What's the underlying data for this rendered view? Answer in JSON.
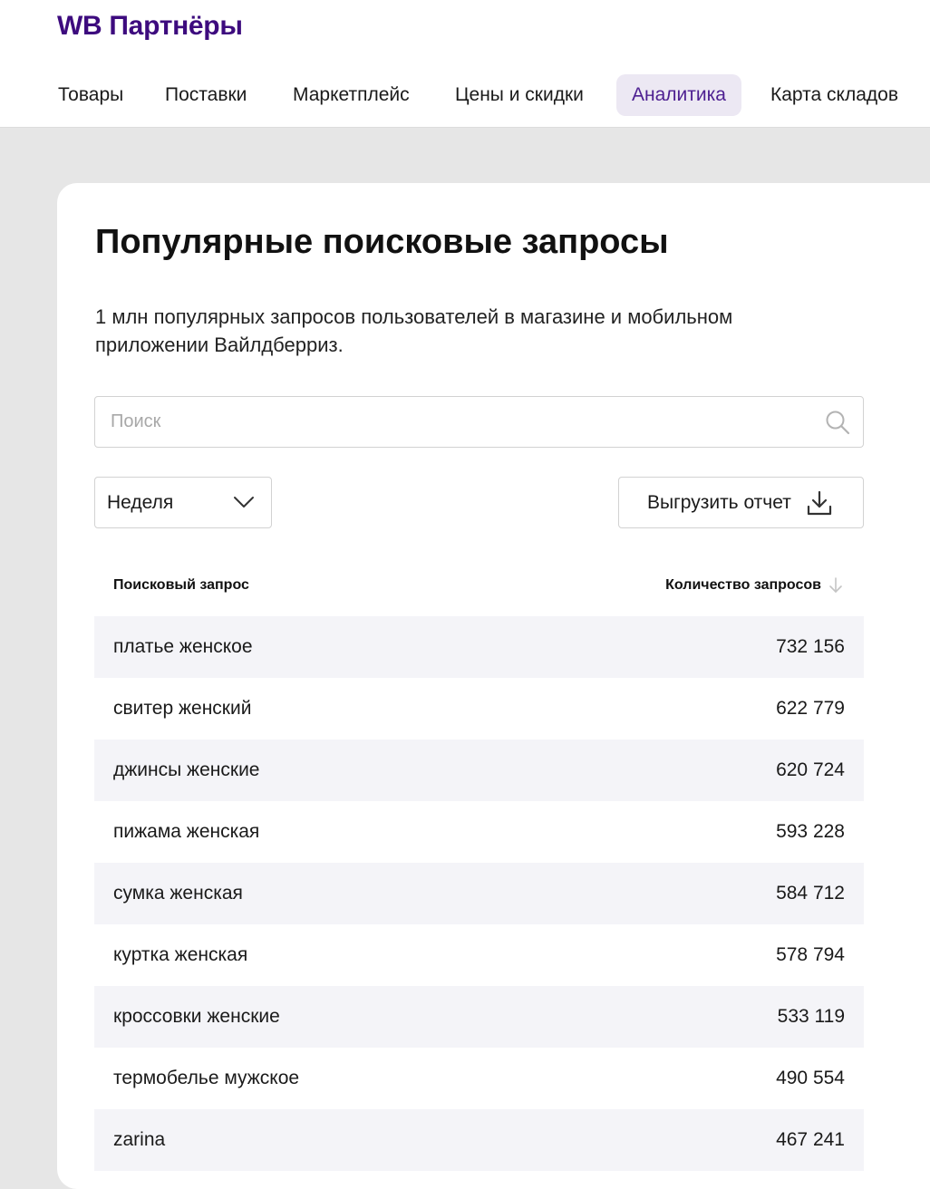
{
  "app": {
    "logo": "WB Партнёры"
  },
  "nav": {
    "items": [
      {
        "label": "Товары",
        "active": false
      },
      {
        "label": "Поставки",
        "active": false
      },
      {
        "label": "Маркетплейс",
        "active": false
      },
      {
        "label": "Цены и скидки",
        "active": false
      },
      {
        "label": "Аналитика",
        "active": true
      },
      {
        "label": "Карта складов",
        "active": false
      }
    ]
  },
  "page": {
    "title": "Популярные поисковые запросы",
    "description": "1 млн популярных запросов пользователей в магазине и мобильном приложении Вайлдберриз."
  },
  "search": {
    "placeholder": "Поиск",
    "value": "",
    "icon": "search-icon"
  },
  "period_select": {
    "value": "Неделя",
    "icon": "chevron-down-icon"
  },
  "export_button": {
    "label": "Выгрузить отчет",
    "icon": "download-icon"
  },
  "table": {
    "columns": {
      "query": "Поисковый запрос",
      "count": "Количество запросов",
      "sort_icon": "arrow-down-icon"
    },
    "rows": [
      {
        "query": "платье женское",
        "count": "732 156"
      },
      {
        "query": "свитер женский",
        "count": "622 779"
      },
      {
        "query": "джинсы женские",
        "count": "620 724"
      },
      {
        "query": "пижама женская",
        "count": "593 228"
      },
      {
        "query": "сумка женская",
        "count": "584 712"
      },
      {
        "query": "куртка женская",
        "count": "578 794"
      },
      {
        "query": "кроссовки женские",
        "count": "533 119"
      },
      {
        "query": "термобелье мужское",
        "count": "490 554"
      },
      {
        "query": "zarina",
        "count": "467 241"
      }
    ]
  },
  "colors": {
    "brand": "#3d0b7e",
    "active_tab_bg": "#ece8f3",
    "active_tab_text": "#4d1f91",
    "page_bg": "#e6e6e6",
    "row_stripe": "#f4f4f8"
  }
}
